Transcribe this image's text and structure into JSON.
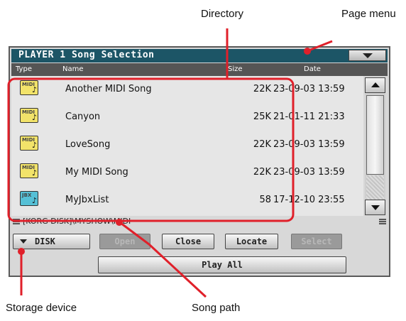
{
  "callouts": {
    "directory": "Directory",
    "page_menu": "Page menu",
    "storage_device": "Storage device",
    "song_path": "Song path"
  },
  "window": {
    "title": "PLAYER 1 Song Selection",
    "page_menu_icon": "triangle-down-icon"
  },
  "columns": {
    "type": "Type",
    "name": "Name",
    "size": "Size",
    "date": "Date"
  },
  "files": [
    {
      "type": "MIDI",
      "name": "Another MIDI Song",
      "size": "22K",
      "date": "23-09-03 13:59"
    },
    {
      "type": "MIDI",
      "name": "Canyon",
      "size": "25K",
      "date": "21-01-11 21:33"
    },
    {
      "type": "MIDI",
      "name": "LoveSong",
      "size": "22K",
      "date": "23-09-03 13:59"
    },
    {
      "type": "MIDI",
      "name": "My MIDI Song",
      "size": "22K",
      "date": "23-09-03 13:59"
    },
    {
      "type": "JBX",
      "name": "MyJbxList",
      "size": "58",
      "date": "17-12-10 23:55"
    }
  ],
  "path": "[KORG DISK]\\MYSHOW\\MIDI",
  "buttons": {
    "disk": "DISK",
    "open": "Open",
    "close": "Close",
    "locate": "Locate",
    "select": "Select",
    "play_all": "Play All"
  },
  "colors": {
    "title_bar": "#1c5566",
    "callout_lines": "#e0202a",
    "midi_icon": "#f2e36a",
    "jbx_icon": "#56c0d6"
  }
}
